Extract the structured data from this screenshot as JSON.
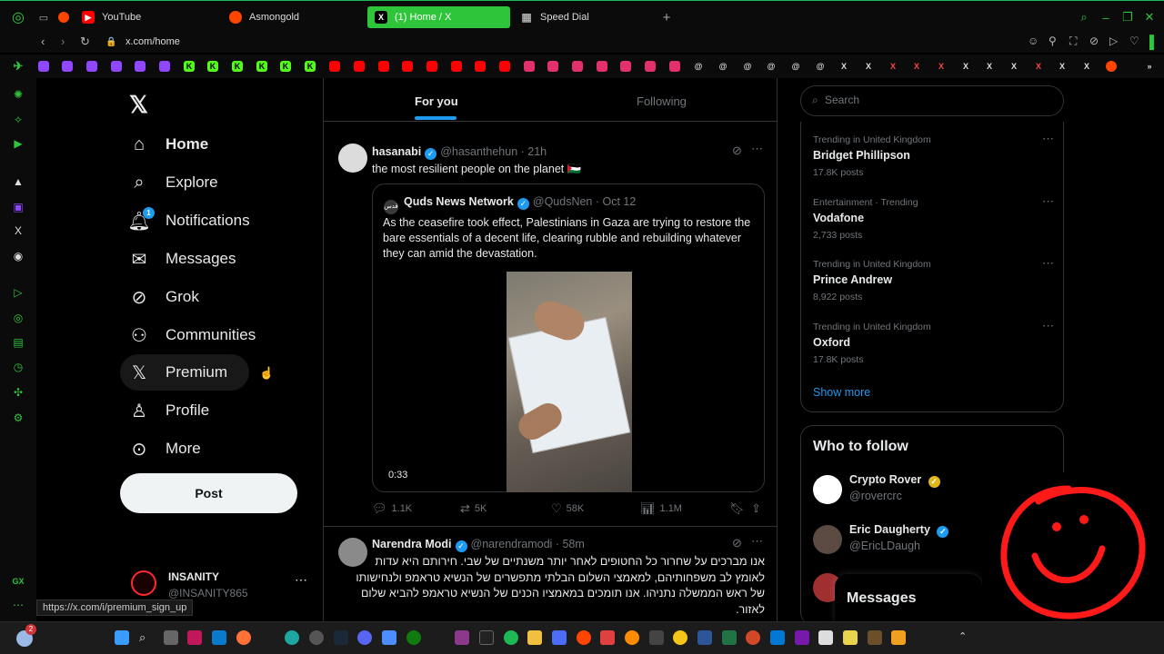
{
  "browser": {
    "tabs": [
      {
        "label": "YouTube",
        "icon": "youtube-icon",
        "color": "#ff0000"
      },
      {
        "label": "Asmongold",
        "icon": "reddit-icon",
        "color": "#ff4500"
      },
      {
        "label": "(1) Home / X",
        "icon": "x-icon",
        "color": "#2fc53b",
        "active": true
      },
      {
        "label": "Speed Dial",
        "icon": "grid-icon",
        "color": "#999999"
      }
    ],
    "url": "x.com/home",
    "status_url": "https://x.com/i/premium_sign_up"
  },
  "nav": {
    "items": [
      {
        "label": "Home",
        "icon": "home-icon"
      },
      {
        "label": "Explore",
        "icon": "search-icon"
      },
      {
        "label": "Notifications",
        "icon": "bell-icon",
        "badge": "1"
      },
      {
        "label": "Messages",
        "icon": "mail-icon"
      },
      {
        "label": "Grok",
        "icon": "grok-icon"
      },
      {
        "label": "Communities",
        "icon": "people-icon"
      },
      {
        "label": "Premium",
        "icon": "x-premium-icon"
      },
      {
        "label": "Profile",
        "icon": "person-icon"
      },
      {
        "label": "More",
        "icon": "more-circle-icon"
      }
    ],
    "post_label": "Post",
    "account": {
      "name": "INSANITY",
      "handle": "@INSANITY865"
    }
  },
  "feed": {
    "tabs": [
      "For you",
      "Following"
    ],
    "tweet1": {
      "name": "hasanabi",
      "handle": "@hasanthehun",
      "time": "21h",
      "text": "the most resilient people on the planet",
      "flag": "🇵🇸",
      "quote": {
        "name": "Quds News Network",
        "handle": "@QudsNen",
        "date": "Oct 12",
        "text": "As the ceasefire took effect, Palestinians in Gaza are trying to restore the bare essentials of a decent life, clearing rubble and rebuilding whatever they can amid the devastation.",
        "duration": "0:33"
      },
      "replies": "1.1K",
      "reposts": "5K",
      "likes": "58K",
      "views": "1.1M"
    },
    "tweet2": {
      "name": "Narendra Modi",
      "handle": "@narendramodi",
      "time": "58m",
      "text": "אנו מברכים על שחרור כל החטופים לאחר יותר משנתיים של שבי. חירותם היא עדות לאומץ לב משפחותיהם, למאמצי השלום הבלתי מתפשרים של הנשיא טראמפ ולנחישותו של ראש הממשלה נתניהו. אנו תומכים במאמציו הכנים של הנשיא טראמפ להביא שלום לאזור."
    }
  },
  "right": {
    "search_placeholder": "Search",
    "trends": [
      {
        "context": "Trending in United Kingdom",
        "name": "Bridget Phillipson",
        "count": "17.8K posts"
      },
      {
        "context": "Entertainment · Trending",
        "name": "Vodafone",
        "count": "2,733 posts"
      },
      {
        "context": "Trending in United Kingdom",
        "name": "Prince Andrew",
        "count": "8,922 posts"
      },
      {
        "context": "Trending in United Kingdom",
        "name": "Oxford",
        "count": "17.8K posts"
      }
    ],
    "show_more": "Show more",
    "who_to_follow": "Who to follow",
    "follow": [
      {
        "name": "Crypto Rover",
        "handle": "@rovercrc"
      },
      {
        "name": "Eric Daugherty",
        "handle": "@EricLDaugh"
      }
    ],
    "messages_label": "Messages"
  },
  "colors": {
    "accent": "#1d9bf0",
    "opera_green": "#2fc53b",
    "smiley": "#ff1a1a"
  },
  "taskbar": {
    "notification_count": "2"
  }
}
